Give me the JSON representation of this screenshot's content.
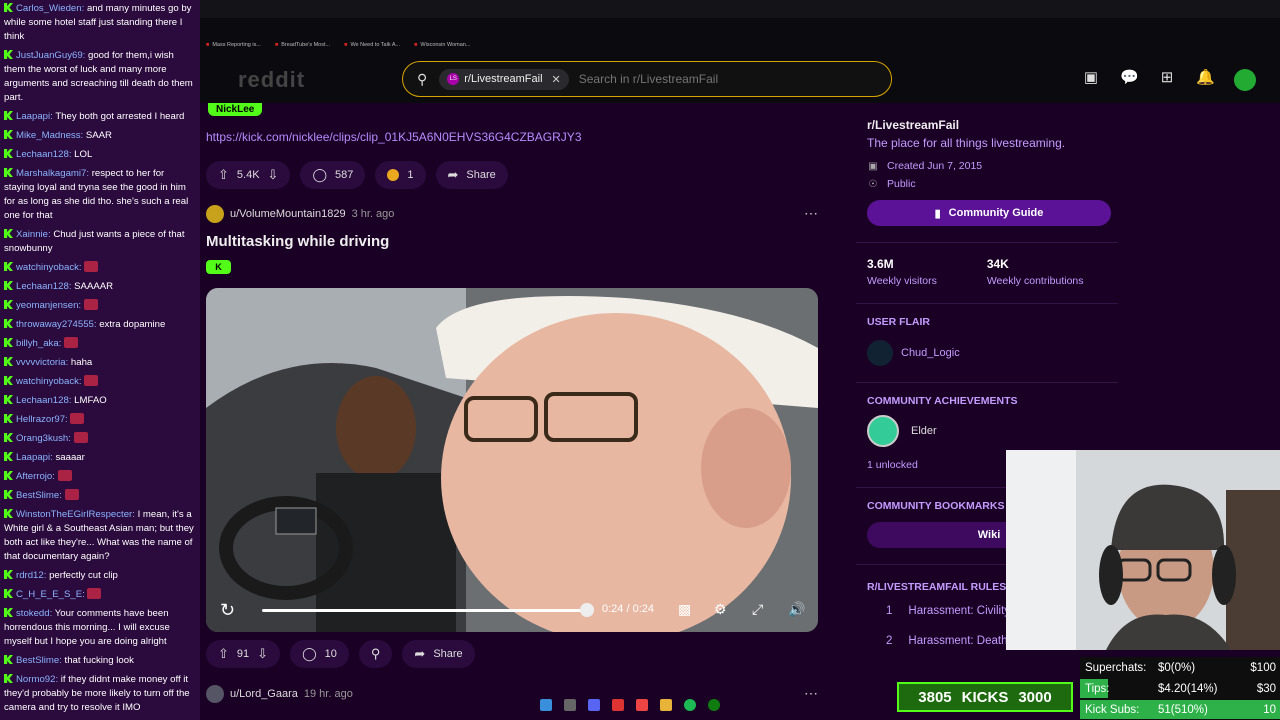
{
  "chat": [
    {
      "user": "Carlos_Wieden:",
      "msg": "and many minutes go by while some hotel staff just standing there I think"
    },
    {
      "user": "JustJuanGuy69:",
      "msg": "good for them,i wish them the worst of luck and many more arguments and screaching till death do them part."
    },
    {
      "user": "Laapapi:",
      "msg": "They both got arrested I heard"
    },
    {
      "user": "Mike_Madness:",
      "msg": "SAAR"
    },
    {
      "user": "Lechaan128:",
      "msg": "LOL"
    },
    {
      "user": "Marshalkagami7:",
      "msg": "respect to her for staying loyal and tryna see the good in him for as long as she did tho. she's such a real one for that"
    },
    {
      "user": "Xainnie:",
      "msg": "Chud just wants a piece of that snowbunny"
    },
    {
      "user": "watchinyoback:",
      "msg": "",
      "emote": true
    },
    {
      "user": "Lechaan128:",
      "msg": "SAAAAR"
    },
    {
      "user": "yeomanjensen:",
      "msg": "",
      "emote": true
    },
    {
      "user": "throwaway274555:",
      "msg": "extra dopamine"
    },
    {
      "user": "billyh_aka:",
      "msg": "",
      "emote": true
    },
    {
      "user": "vvvvvictoria:",
      "msg": "haha"
    },
    {
      "user": "watchinyoback:",
      "msg": "",
      "emote": true
    },
    {
      "user": "Lechaan128:",
      "msg": "LMFAO"
    },
    {
      "user": "Hellrazor97:",
      "msg": "",
      "emote": true
    },
    {
      "user": "Orang3kush:",
      "msg": "",
      "emote": true
    },
    {
      "user": "Laapapi:",
      "msg": "saaaar"
    },
    {
      "user": "Afterrojo:",
      "msg": "",
      "emote": true
    },
    {
      "user": "BestSlime:",
      "msg": "",
      "emote": true
    },
    {
      "user": "WinstonTheEGirlRespecter:",
      "msg": "I mean, it's a White girl & a Southeast Asian man; but they both act like they're... What was the name of that documentary again?"
    },
    {
      "user": "rdrd12:",
      "msg": "perfectly cut clip"
    },
    {
      "user": "C_H_E_E_S_E:",
      "msg": "",
      "emote": true
    },
    {
      "user": "stokedd:",
      "msg": "Your comments have been horrendous this morning... I will excuse myself but I hope you are doing alright"
    },
    {
      "user": "BestSlime:",
      "msg": "that fucking look"
    },
    {
      "user": "Normo92:",
      "msg": "if they didnt make money off it they'd probably be more likely to turn off the camera and try to resolve it IMO"
    }
  ],
  "bookmarks": [
    "Mass Reporting is...",
    "BreadTube's Most...",
    "We Need to Talk A...",
    "Wisconsin Woman..."
  ],
  "header": {
    "logo": "reddit",
    "chip_label": "r/LivestreamFail",
    "search_placeholder": "Search in r/LivestreamFail"
  },
  "post1": {
    "flair": "NickLee",
    "link": "https://kick.com/nicklee/clips/clip_01KJ5A6N0EHVS36G4CZBAGRJY3",
    "votes": "5.4K",
    "comments": "587",
    "awards": "1",
    "share": "Share"
  },
  "post2": {
    "author": "u/VolumeMountain1829",
    "time": "3 hr. ago",
    "title": "Multitasking while driving",
    "video_time": "0:24 / 0:24",
    "video_progress": 1.0,
    "votes": "91",
    "comments": "10",
    "share": "Share"
  },
  "post3": {
    "author": "u/Lord_Gaara",
    "time": "19 hr. ago"
  },
  "sidebar": {
    "title": "r/LivestreamFail",
    "desc": "The place for all things livestreaming.",
    "created": "Created Jun 7, 2015",
    "visibility": "Public",
    "guide": "Community Guide",
    "visitors_num": "3.6M",
    "visitors_lbl": "Weekly visitors",
    "contrib_num": "34K",
    "contrib_lbl": "Weekly contributions",
    "user_flair_title": "USER FLAIR",
    "user_flair": "Chud_Logic",
    "ach_title": "COMMUNITY ACHIEVEMENTS",
    "ach_name": "Elder",
    "unlocked": "1 unlocked",
    "bookmarks_title": "COMMUNITY BOOKMARKS",
    "wiki": "Wiki",
    "rules_title": "R/LIVESTREAMFAIL RULES",
    "rule1_num": "1",
    "rule1": "Harassment: Civility",
    "rule2_num": "2",
    "rule2": "Harassment: Death & Violence"
  },
  "overlay": {
    "kicks_current": "3805",
    "kicks_label": "KICKS",
    "kicks_goal": "3000",
    "kicks_progress": 1.0,
    "goals": [
      {
        "label": "Superchats:",
        "value": "$0(0%)",
        "goal": "$100",
        "progress": 0.0
      },
      {
        "label": "Tips:",
        "value": "$4.20(14%)",
        "goal": "$30",
        "progress": 0.14
      },
      {
        "label": "Kick Subs:",
        "value": "51(510%)",
        "goal": "10",
        "progress": 1.0
      }
    ]
  },
  "colors": {
    "kick_green": "#53fc18",
    "reddit_purple": "#1a0024",
    "accent": "#5b1296"
  }
}
